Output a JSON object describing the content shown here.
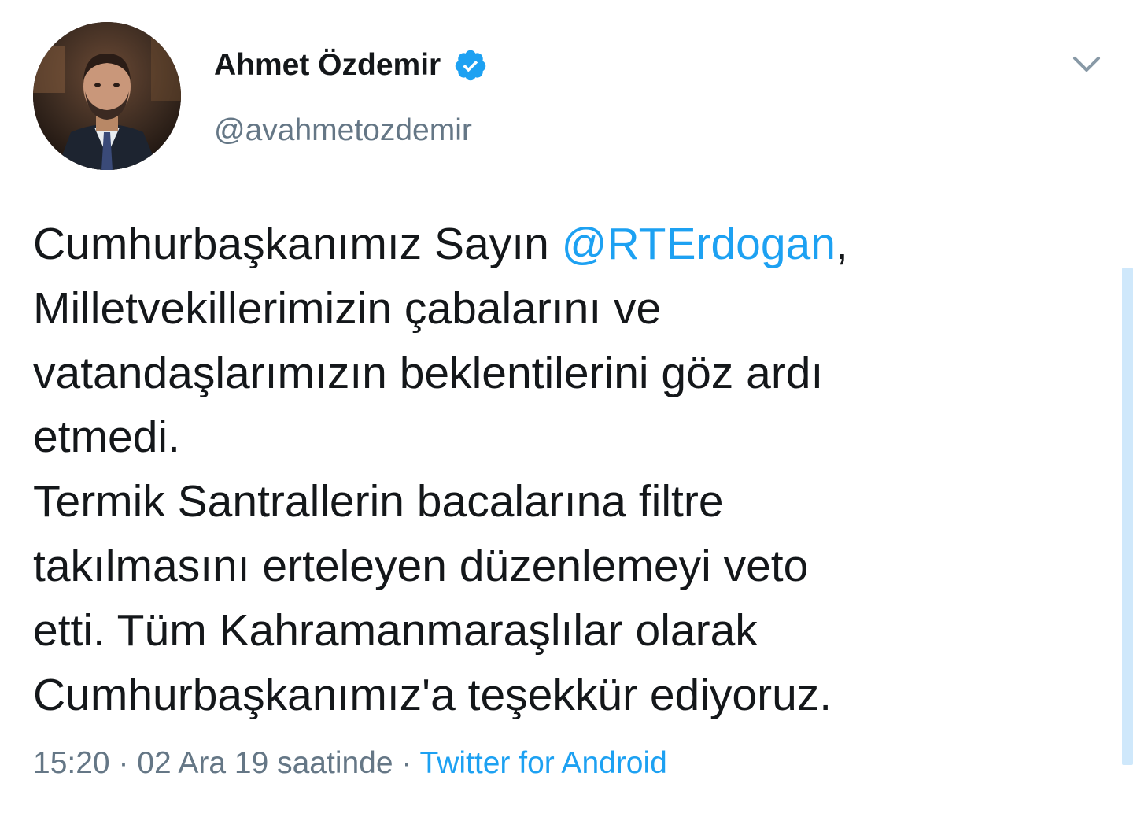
{
  "user": {
    "display_name": "Ahmet Özdemir",
    "handle": "@avahmetozdemir",
    "verified": true
  },
  "tweet": {
    "text_before_mention": "Cumhurbaşkanımız Sayın ",
    "mention": "@RTErdogan",
    "text_after_mention": ",\nMilletvekillerimizin çabalarını ve\nvatandaşlarımızın beklentilerini göz ardı\netmedi.\nTermik Santrallerin bacalarına filtre\ntakılmasını erteleyen düzenlemeyi veto\netti. Tüm Kahramanmaraşlılar olarak\nCumhurbaşkanımız'a teşekkür ediyoruz.",
    "time": "15:20",
    "date": "02 Ara 19 saatinde",
    "separator": "·",
    "source": "Twitter for Android"
  },
  "icons": {
    "verified": "verified-badge-icon",
    "menu": "chevron-down-icon"
  },
  "colors": {
    "accent": "#1da1f2",
    "text": "#14171a",
    "secondary": "#657786",
    "scrollbar": "#cfe8fb"
  }
}
